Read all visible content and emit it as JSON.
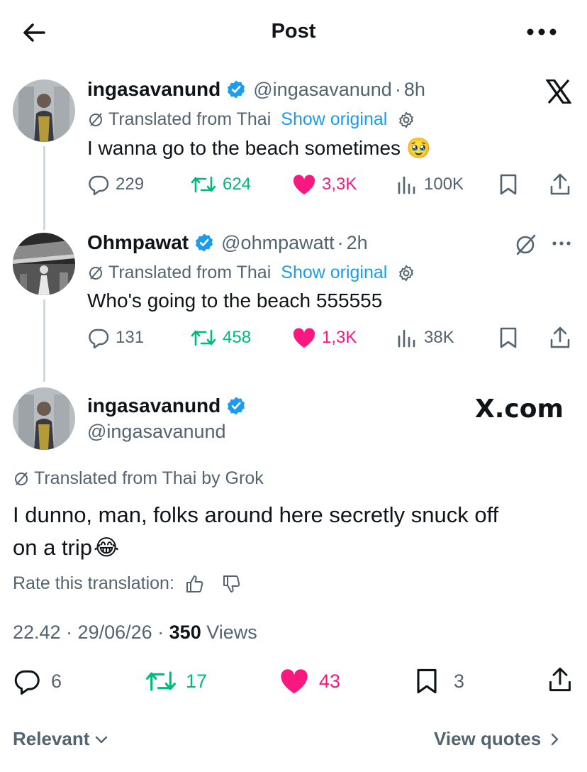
{
  "header": {
    "title": "Post"
  },
  "tweet1": {
    "name": "ingasavanund",
    "handle": "@ingasavanund",
    "time": "8h",
    "translated": "Translated from Thai",
    "show_original": "Show original",
    "text": "I wanna go to the beach sometimes",
    "emoji": "🥹",
    "replies": "229",
    "reposts": "624",
    "likes": "3,3K",
    "views": "100K"
  },
  "tweet2": {
    "name": "Ohmpawat",
    "handle": "@ohmpawatt",
    "time": "2h",
    "translated": "Translated from Thai",
    "show_original": "Show original",
    "text": "Who's going to the beach 555555",
    "replies": "131",
    "reposts": "458",
    "likes": "1,3K",
    "views": "38K"
  },
  "main": {
    "name": "ingasavanund",
    "handle": "@ingasavanund",
    "brand": "X.com",
    "translated": "Translated from Thai by Grok",
    "text_line1": "I dunno, man, folks around here secretly snuck off",
    "text_line2": "on a trip",
    "emoji": "😂",
    "rate": "Rate this translation:",
    "timestamp": "22.42 · 29/06/26 · ",
    "views_count": "350",
    "views_label": " Views",
    "replies": "6",
    "reposts": "17",
    "likes": "43",
    "bookmarks": "3"
  },
  "footer": {
    "sort": "Relevant",
    "quotes": "View quotes"
  },
  "colors": {
    "accent": "#1d9bf0",
    "like": "#f91880",
    "repost": "#00ba7c",
    "muted": "#536471"
  }
}
